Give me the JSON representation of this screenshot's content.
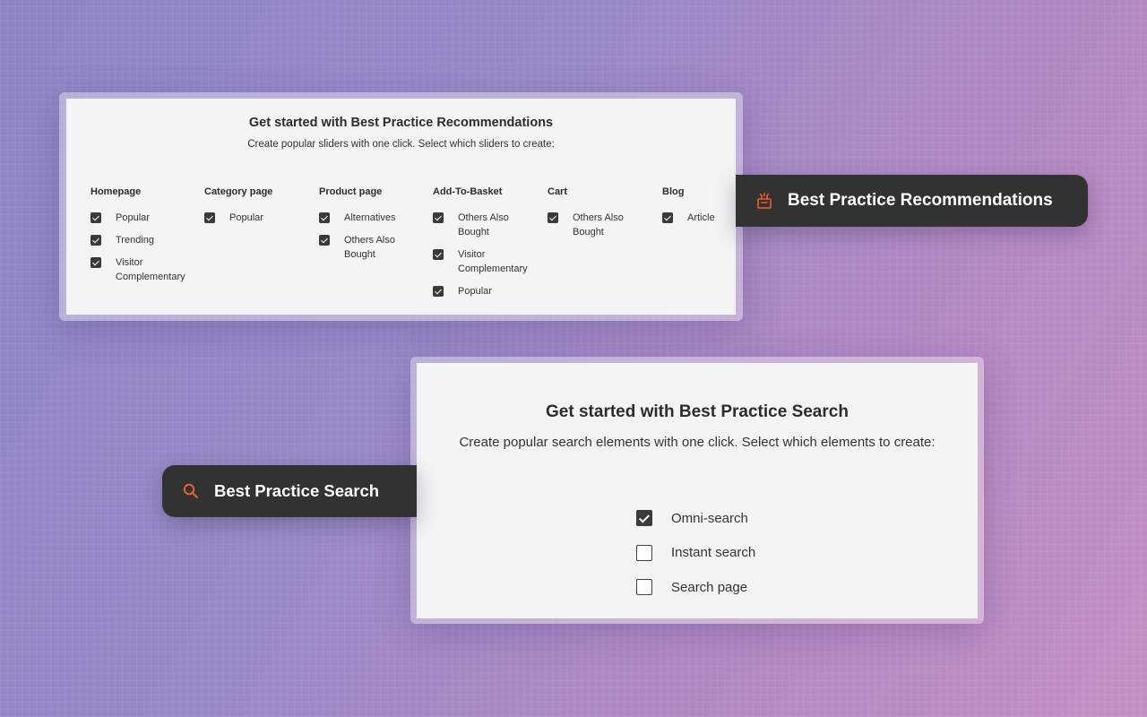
{
  "recommendations": {
    "title": "Get started with Best Practice Recommendations",
    "subtitle": "Create popular sliders with one click. Select which sliders to create:",
    "columns": [
      {
        "heading": "Homepage",
        "options": [
          {
            "label": "Popular",
            "checked": true
          },
          {
            "label": "Trending",
            "checked": true
          },
          {
            "label": "Visitor Complementary",
            "checked": true
          }
        ]
      },
      {
        "heading": "Category page",
        "options": [
          {
            "label": "Popular",
            "checked": true
          }
        ]
      },
      {
        "heading": "Product page",
        "options": [
          {
            "label": "Alternatives",
            "checked": true
          },
          {
            "label": "Others Also Bought",
            "checked": true
          }
        ]
      },
      {
        "heading": "Add-To-Basket",
        "options": [
          {
            "label": "Others Also Bought",
            "checked": true
          },
          {
            "label": "Visitor Complementary",
            "checked": true
          },
          {
            "label": "Popular",
            "checked": true
          }
        ]
      },
      {
        "heading": "Cart",
        "options": [
          {
            "label": "Others Also Bought",
            "checked": true
          }
        ]
      },
      {
        "heading": "Blog",
        "options": [
          {
            "label": "Article",
            "checked": true
          }
        ]
      }
    ]
  },
  "recommendations_badge": {
    "label": "Best Practice Recommendations",
    "icon": "gift-hand-icon"
  },
  "search": {
    "title": "Get started with Best Practice Search",
    "subtitle": "Create popular search elements with one click. Select which elements to create:",
    "options": [
      {
        "label": "Omni-search",
        "checked": true
      },
      {
        "label": "Instant search",
        "checked": false
      },
      {
        "label": "Search page",
        "checked": false
      }
    ]
  },
  "search_badge": {
    "label": "Best Practice Search",
    "icon": "search-icon"
  },
  "colors": {
    "accent": "#e8622c",
    "pill_bg": "#323232",
    "panel_bg": "#f4f4f4"
  }
}
